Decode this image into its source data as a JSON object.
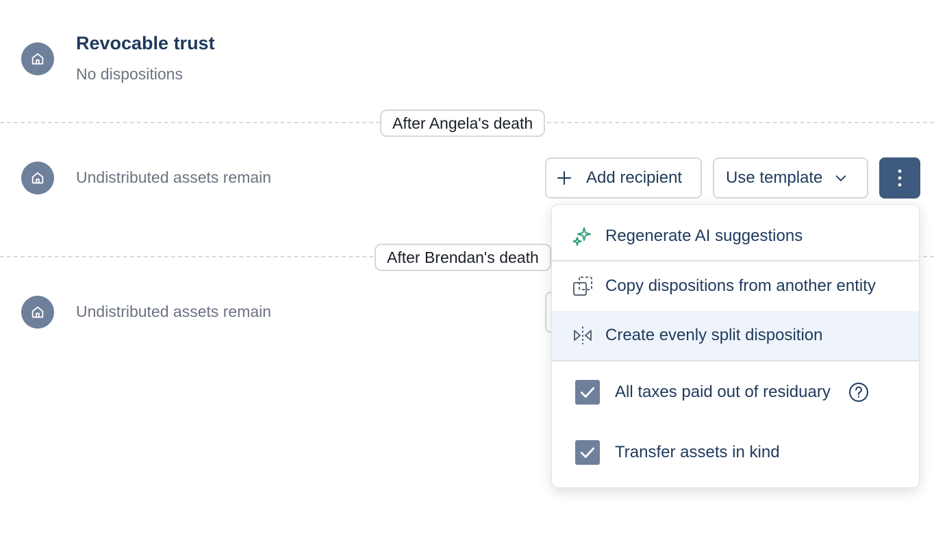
{
  "entity": {
    "name": "Revocable trust",
    "subtitle": "No dispositions"
  },
  "sections": [
    {
      "divider_label": "After Angela's death",
      "row_text": "Undistributed assets remain"
    },
    {
      "divider_label": "After Brendan's death",
      "row_text": "Undistributed assets remain"
    }
  ],
  "toolbar": {
    "add_recipient_label": "Add recipient",
    "use_template_label": "Use template"
  },
  "menu": {
    "items": [
      {
        "label": "Regenerate AI suggestions",
        "icon": "sparkle-icon"
      },
      {
        "label": "Copy dispositions from another entity",
        "icon": "copy-icon"
      },
      {
        "label": "Create evenly split disposition",
        "icon": "split-icon"
      }
    ],
    "options": [
      {
        "label": "All taxes paid out of residuary",
        "checked": true,
        "help": true
      },
      {
        "label": "Transfer assets in kind",
        "checked": true,
        "help": false
      }
    ]
  },
  "colors": {
    "avatar": "#6f809b",
    "primary_button": "#3e5a7e",
    "text_dark": "#1f3a5c",
    "text_muted": "#6b7380",
    "ai_accent": "#2f9e7d",
    "highlight": "#eff4fb"
  }
}
